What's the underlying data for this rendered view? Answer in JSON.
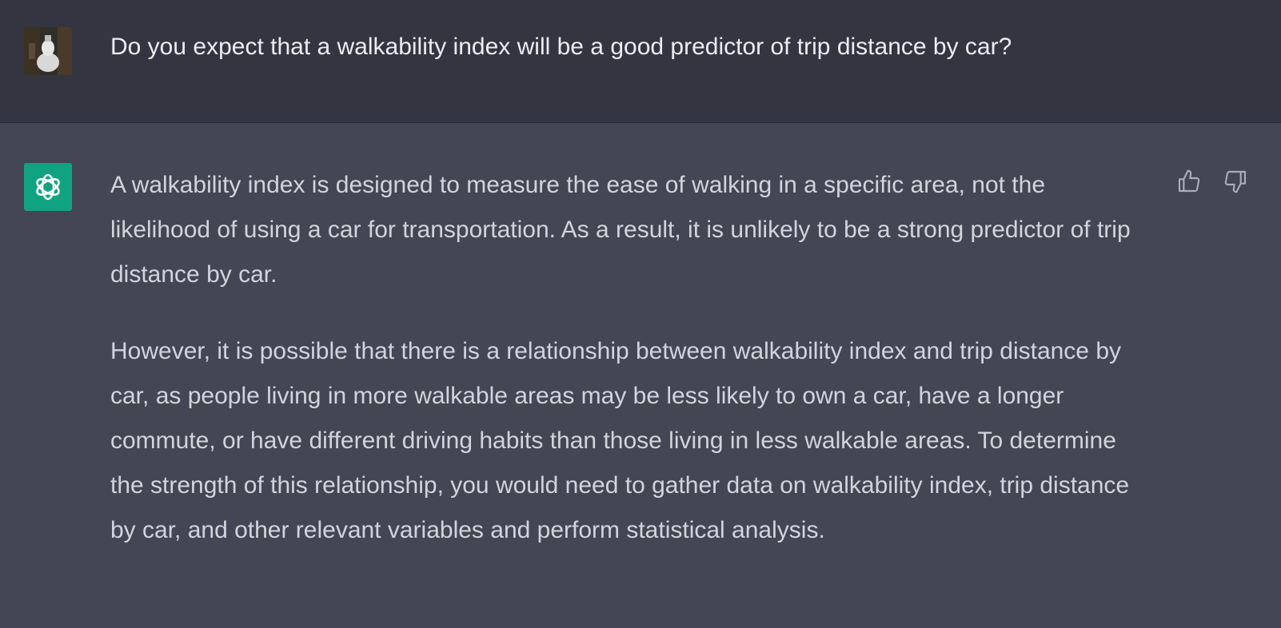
{
  "user_message": {
    "text": "Do you expect that a walkability index will be a good predictor of trip distance by car?"
  },
  "assistant_message": {
    "paragraphs": [
      "A walkability index is designed to measure the ease of walking in a specific area, not the likelihood of using a car for transportation. As a result, it is unlikely to be a strong predictor of trip distance by car.",
      "However, it is possible that there is a relationship between walkability index and trip distance by car, as people living in more walkable areas may be less likely to own a car, have a longer commute, or have different driving habits than those living in less walkable areas. To determine the strength of this relationship, you would need to gather data on walkability index, trip distance by car, and other relevant variables and perform statistical analysis."
    ]
  },
  "icons": {
    "user_avatar": "user-photo-avatar",
    "assistant_avatar": "openai-logo-icon",
    "like": "thumbs-up-icon",
    "dislike": "thumbs-down-icon"
  },
  "colors": {
    "user_bg": "#343541",
    "assistant_bg": "#444654",
    "bot_avatar_bg": "#10a37f"
  }
}
